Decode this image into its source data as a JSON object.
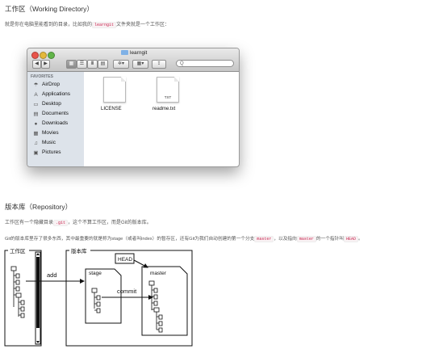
{
  "section1": {
    "heading": "工作区（Working Directory）",
    "text_before": "就是你在电脑里能看到的目录，比如我的",
    "code": "learngit",
    "text_after": "文件夹就是一个工作区："
  },
  "finder": {
    "title": "learngit",
    "search_placeholder": "Q",
    "sidebar_header": "FAVORITES",
    "sidebar_items": [
      {
        "label": "AirDrop",
        "icon": "airdrop-icon"
      },
      {
        "label": "Applications",
        "icon": "applications-icon"
      },
      {
        "label": "Desktop",
        "icon": "desktop-icon"
      },
      {
        "label": "Documents",
        "icon": "documents-icon"
      },
      {
        "label": "Downloads",
        "icon": "downloads-icon"
      },
      {
        "label": "Movies",
        "icon": "movies-icon"
      },
      {
        "label": "Music",
        "icon": "music-icon"
      },
      {
        "label": "Pictures",
        "icon": "pictures-icon"
      }
    ],
    "files": [
      {
        "name": "LICENSE",
        "badge": ""
      },
      {
        "name": "readme.txt",
        "badge": "TXT"
      }
    ]
  },
  "section2": {
    "heading": "版本库（Repository）",
    "line1_before": "工作区有一个隐藏目录",
    "line1_code": ".git",
    "line1_after": "，这个不算工作区，而是Git的版本库。",
    "line2_a": "Git的版本库里存了很多东西，其中最重要的就是称为stage（或者叫index）的暂存区，还有Git为我们自动创建的第一个分支",
    "line2_code1": "master",
    "line2_b": "，以及指向",
    "line2_code2": "master",
    "line2_c": "的一个指针叫",
    "line2_code3": "HEAD",
    "line2_d": "。"
  },
  "diagram": {
    "workspace_label": "工作区",
    "repo_label": "版本库",
    "stage_label": "stage",
    "master_label": "master",
    "head_label": "HEAD",
    "add_label": "add",
    "commit_label": "commit"
  }
}
